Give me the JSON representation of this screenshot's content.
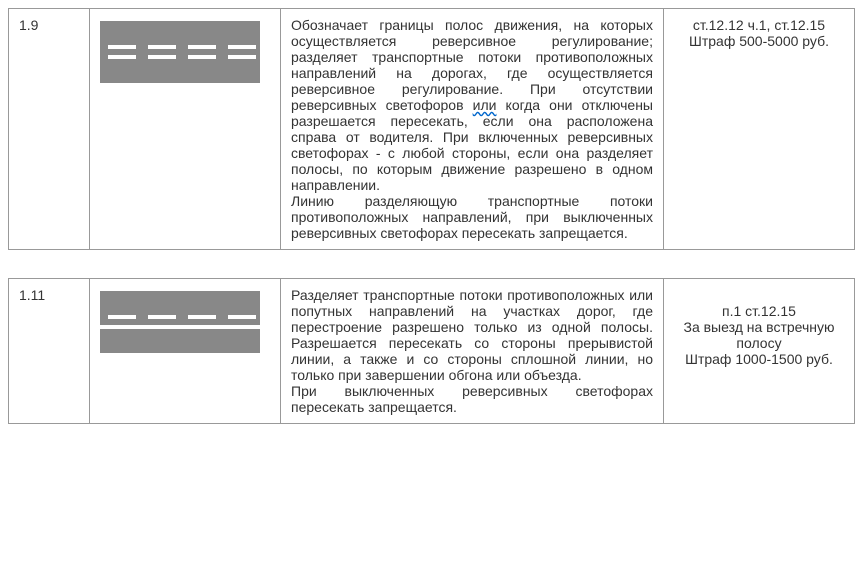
{
  "rows": [
    {
      "number": "1.9",
      "marking_type": "double-dashed",
      "desc_before_wavy": "Обозначает границы полос движения, на которых осуществляется реверсивное регулирование; разделяет транспортные потоки противоположных направлений на дорогах, где осуществляется реверсивное регулирование. При отсутствии реверсивных светофоров ",
      "desc_wavy": "или",
      "desc_after_wavy": " когда они отключены разрешается пересекать, если она расположена справа от водителя. При включенных реверсивных светофорах - с любой стороны, если она разделяет полосы, по которым движение разрешено в одном направлении.",
      "desc_para2": "Линию разделяющую транспортные потоки противоположных направлений, при выключенных реверсивных светофорах пересекать запрещается.",
      "fine_line1": "ст.12.12 ч.1, ст.12.15",
      "fine_line2": "Штраф 500-5000 руб."
    },
    {
      "number": "1.11",
      "marking_type": "solid-plus-dashed",
      "desc_before_wavy": "Разделяет транспортные потоки противоположных или попутных направлений на участках дорог, где перестроение разрешено только из одной полосы. Разрешается пересекать со стороны прерывистой линии, а также и со стороны сплошной линии, но только при завершении обгона или объезда.",
      "desc_wavy": "",
      "desc_after_wavy": "",
      "desc_para2": "При выключенных реверсивных светофорах пересекать запрещается.",
      "fine_line1": "п.1 ст.12.15",
      "fine_line2": "За выезд на встречную полосу",
      "fine_line3": "Штраф 1000-1500 руб."
    }
  ]
}
